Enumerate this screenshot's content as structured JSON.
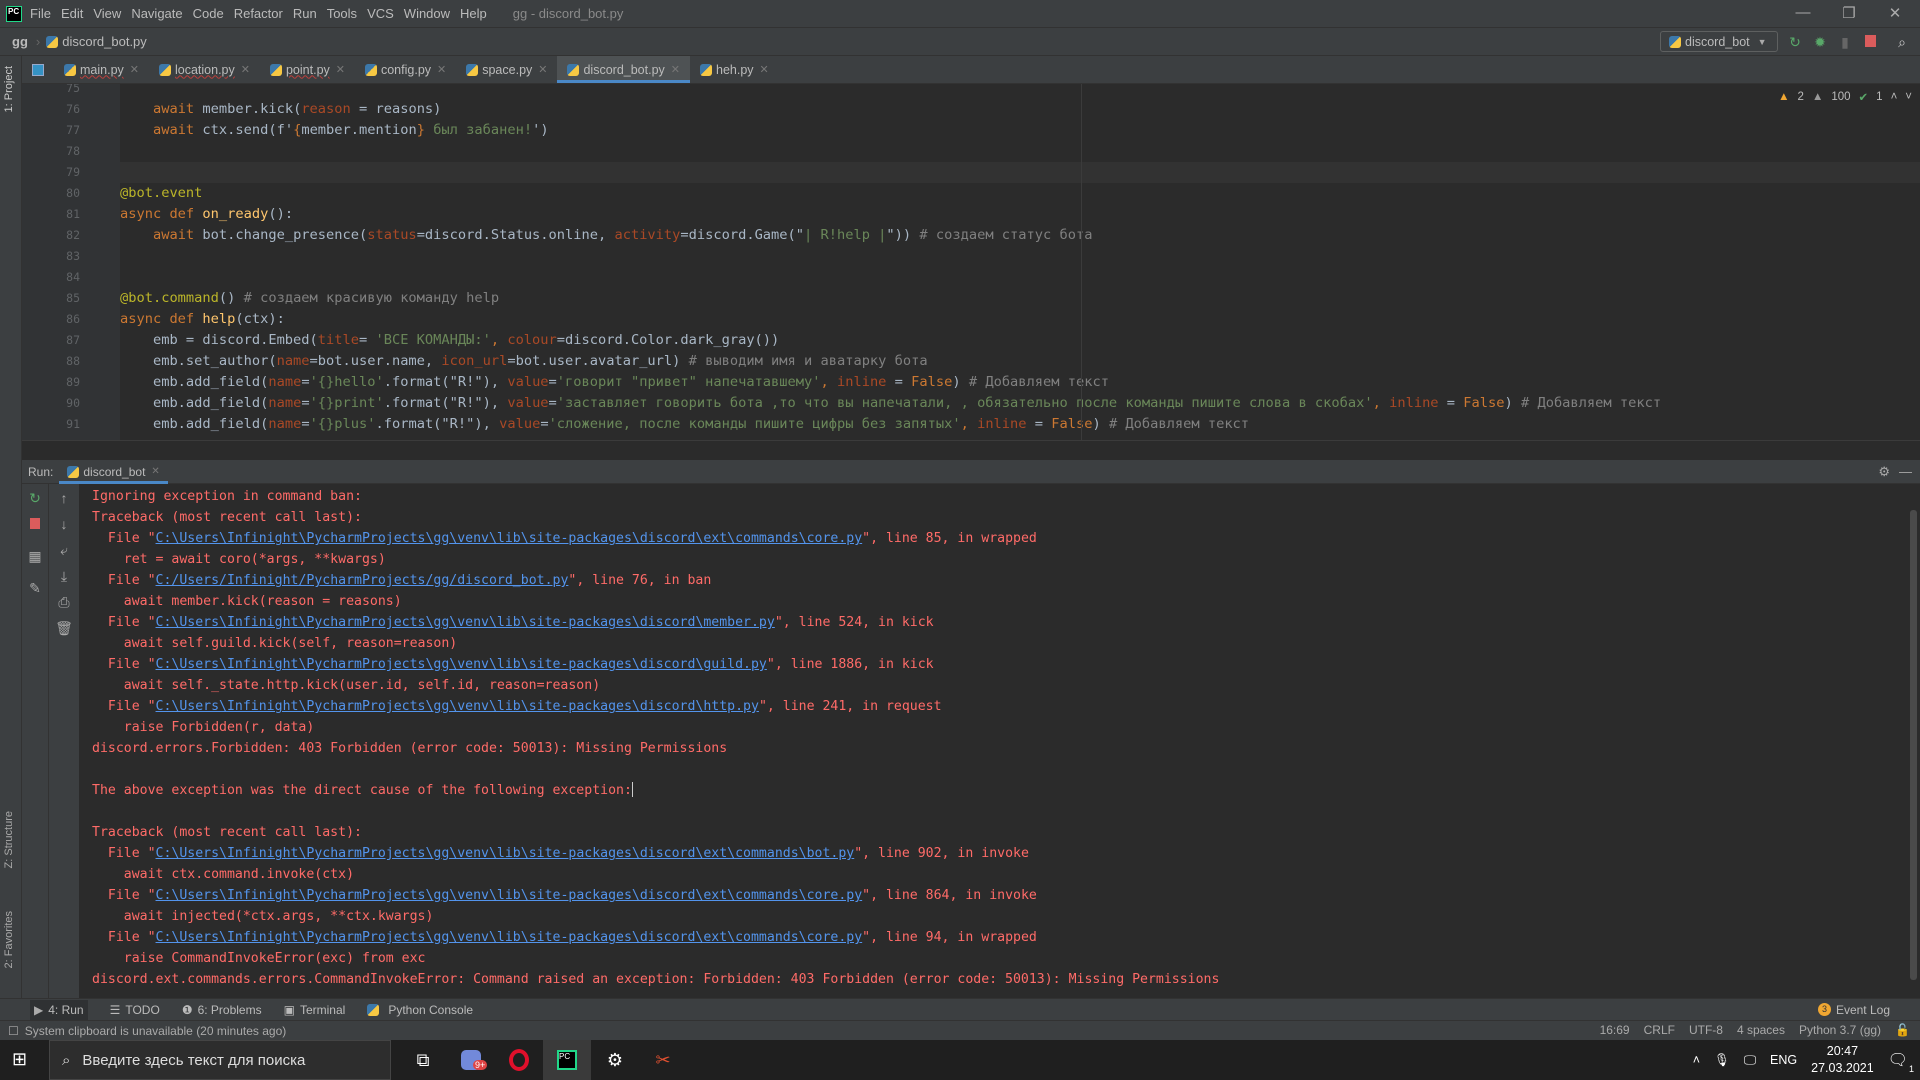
{
  "titlebar": {
    "menu": [
      "File",
      "Edit",
      "View",
      "Navigate",
      "Code",
      "Refactor",
      "Run",
      "Tools",
      "VCS",
      "Window",
      "Help"
    ],
    "window_title": "gg - discord_bot.py"
  },
  "navbar": {
    "breadcrumb": [
      "gg",
      "discord_bot.py"
    ],
    "run_config": "discord_bot"
  },
  "left_strip": {
    "project": "1: Project",
    "structure": "Z: Structure",
    "favorites": "2: Favorites"
  },
  "tabs": [
    {
      "label": "main.py",
      "active": false
    },
    {
      "label": "location.py",
      "active": false
    },
    {
      "label": "point.py",
      "active": false
    },
    {
      "label": "config.py",
      "active": false
    },
    {
      "label": "space.py",
      "active": false
    },
    {
      "label": "discord_bot.py",
      "active": true
    },
    {
      "label": "heh.py",
      "active": false
    }
  ],
  "inspections": {
    "warnings": "2",
    "weak_warnings": "100",
    "typos": "1"
  },
  "editor": {
    "current_line": 79,
    "lines": [
      {
        "n": "75",
        "tokens": []
      },
      {
        "n": "76",
        "tokens": [
          [
            "    ",
            "tx"
          ],
          [
            "await ",
            "kw"
          ],
          [
            "member.kick(",
            "tx"
          ],
          [
            "reason",
            "par"
          ],
          [
            " = reasons)",
            "tx"
          ]
        ]
      },
      {
        "n": "77",
        "tokens": [
          [
            "    ",
            "tx"
          ],
          [
            "await ",
            "kw"
          ],
          [
            "ctx.send(f'",
            "tx"
          ],
          [
            "{",
            "kw"
          ],
          [
            "member.mention",
            "tx"
          ],
          [
            "}",
            "kw"
          ],
          [
            " был забанен!",
            "str"
          ],
          [
            "')",
            "tx"
          ]
        ]
      },
      {
        "n": "78",
        "tokens": []
      },
      {
        "n": "79",
        "tokens": []
      },
      {
        "n": "80",
        "tokens": [
          [
            "@bot.event",
            "dec"
          ]
        ]
      },
      {
        "n": "81",
        "tokens": [
          [
            "async def ",
            "kw"
          ],
          [
            "on_ready",
            "fn"
          ],
          [
            "():",
            "tx"
          ]
        ]
      },
      {
        "n": "82",
        "tokens": [
          [
            "    ",
            "tx"
          ],
          [
            "await ",
            "kw"
          ],
          [
            "bot.change_presence(",
            "tx"
          ],
          [
            "status",
            "par"
          ],
          [
            "=discord.Status.online, ",
            "tx"
          ],
          [
            "activity",
            "par"
          ],
          [
            "=discord.Game(\"",
            "tx"
          ],
          [
            "| R!help |",
            "str"
          ],
          [
            "\")) ",
            "tx"
          ],
          [
            "# создаем статус бота",
            "cm"
          ]
        ]
      },
      {
        "n": "83",
        "tokens": []
      },
      {
        "n": "84",
        "tokens": []
      },
      {
        "n": "85",
        "tokens": [
          [
            "@bot.command",
            "dec"
          ],
          [
            "() ",
            "tx"
          ],
          [
            "# создаем красивую команду help",
            "cm"
          ]
        ]
      },
      {
        "n": "86",
        "tokens": [
          [
            "async def ",
            "kw"
          ],
          [
            "help",
            "fn"
          ],
          [
            "(ctx):",
            "tx"
          ]
        ]
      },
      {
        "n": "87",
        "tokens": [
          [
            "    emb = discord.Embed(",
            "tx"
          ],
          [
            "title",
            "par"
          ],
          [
            "= ",
            "tx"
          ],
          [
            "'ВСЕ КОМАНДЫ:'",
            "str"
          ],
          [
            ", ",
            "kw"
          ],
          [
            "colour",
            "par"
          ],
          [
            "=discord.Color.dark_gray())",
            "tx"
          ]
        ]
      },
      {
        "n": "88",
        "tokens": [
          [
            "    emb.set_author(",
            "tx"
          ],
          [
            "name",
            "par"
          ],
          [
            "=bot.user.name, ",
            "tx"
          ],
          [
            "icon_url",
            "par"
          ],
          [
            "=bot.user.avatar_url) ",
            "tx"
          ],
          [
            "# выводим имя и аватарку бота",
            "cm"
          ]
        ]
      },
      {
        "n": "89",
        "tokens": [
          [
            "    emb.add_field(",
            "tx"
          ],
          [
            "name",
            "par"
          ],
          [
            "=",
            "tx"
          ],
          [
            "'{}hello'",
            "str"
          ],
          [
            ".format(\"R!\"), ",
            "tx"
          ],
          [
            "value",
            "par"
          ],
          [
            "=",
            "tx"
          ],
          [
            "'говорит \"привет\" напечатавшему'",
            "str"
          ],
          [
            ", ",
            "kw"
          ],
          [
            "inline",
            "par"
          ],
          [
            " = ",
            "tx"
          ],
          [
            "False",
            "kw"
          ],
          [
            ") ",
            "tx"
          ],
          [
            "# Добавляем текст",
            "cm"
          ]
        ]
      },
      {
        "n": "90",
        "tokens": [
          [
            "    emb.add_field(",
            "tx"
          ],
          [
            "name",
            "par"
          ],
          [
            "=",
            "tx"
          ],
          [
            "'{}print'",
            "str"
          ],
          [
            ".format(\"R!\"), ",
            "tx"
          ],
          [
            "value",
            "par"
          ],
          [
            "=",
            "tx"
          ],
          [
            "'заставляет говорить бота ,то что вы напечатали, , обязательно после команды пишите слова в скобах'",
            "str"
          ],
          [
            ", ",
            "kw"
          ],
          [
            "inline",
            "par"
          ],
          [
            " = ",
            "tx"
          ],
          [
            "False",
            "kw"
          ],
          [
            ") ",
            "tx"
          ],
          [
            "# Добавляем текст",
            "cm"
          ]
        ]
      },
      {
        "n": "91",
        "tokens": [
          [
            "    emb.add_field(",
            "tx"
          ],
          [
            "name",
            "par"
          ],
          [
            "=",
            "tx"
          ],
          [
            "'{}plus'",
            "str"
          ],
          [
            ".format(\"R!\"), ",
            "tx"
          ],
          [
            "value",
            "par"
          ],
          [
            "=",
            "tx"
          ],
          [
            "'сложение, после команды пишите цифры без запятых'",
            "str"
          ],
          [
            ", ",
            "kw"
          ],
          [
            "inline",
            "par"
          ],
          [
            " = ",
            "tx"
          ],
          [
            "False",
            "kw"
          ],
          [
            ") ",
            "tx"
          ],
          [
            "# Добавляем текст",
            "cm"
          ]
        ]
      }
    ]
  },
  "run": {
    "label": "Run:",
    "tab": "discord_bot",
    "output": [
      {
        "pre": "Ignoring exception in command ban:"
      },
      {
        "pre": "Traceback (most recent call last):"
      },
      {
        "pre": "  File \"",
        "link": "C:\\Users\\Infinight\\PycharmProjects\\gg\\venv\\lib\\site-packages\\discord\\ext\\commands\\core.py",
        "post": "\", line 85, in wrapped"
      },
      {
        "pre": "    ret = await coro(*args, **kwargs)"
      },
      {
        "pre": "  File \"",
        "link": "C:/Users/Infinight/PycharmProjects/gg/discord_bot.py",
        "post": "\", line 76, in ban"
      },
      {
        "pre": "    await member.kick(reason = reasons)"
      },
      {
        "pre": "  File \"",
        "link": "C:\\Users\\Infinight\\PycharmProjects\\gg\\venv\\lib\\site-packages\\discord\\member.py",
        "post": "\", line 524, in kick"
      },
      {
        "pre": "    await self.guild.kick(self, reason=reason)"
      },
      {
        "pre": "  File \"",
        "link": "C:\\Users\\Infinight\\PycharmProjects\\gg\\venv\\lib\\site-packages\\discord\\guild.py",
        "post": "\", line 1886, in kick"
      },
      {
        "pre": "    await self._state.http.kick(user.id, self.id, reason=reason)"
      },
      {
        "pre": "  File \"",
        "link": "C:\\Users\\Infinight\\PycharmProjects\\gg\\venv\\lib\\site-packages\\discord\\http.py",
        "post": "\", line 241, in request"
      },
      {
        "pre": "    raise Forbidden(r, data)"
      },
      {
        "pre": "discord.errors.Forbidden: 403 Forbidden (error code: 50013): Missing Permissions"
      },
      {
        "pre": ""
      },
      {
        "pre": "The above exception was the direct cause of the following exception:",
        "caret": true
      },
      {
        "pre": ""
      },
      {
        "pre": "Traceback (most recent call last):"
      },
      {
        "pre": "  File \"",
        "link": "C:\\Users\\Infinight\\PycharmProjects\\gg\\venv\\lib\\site-packages\\discord\\ext\\commands\\bot.py",
        "post": "\", line 902, in invoke"
      },
      {
        "pre": "    await ctx.command.invoke(ctx)"
      },
      {
        "pre": "  File \"",
        "link": "C:\\Users\\Infinight\\PycharmProjects\\gg\\venv\\lib\\site-packages\\discord\\ext\\commands\\core.py",
        "post": "\", line 864, in invoke"
      },
      {
        "pre": "    await injected(*ctx.args, **ctx.kwargs)"
      },
      {
        "pre": "  File \"",
        "link": "C:\\Users\\Infinight\\PycharmProjects\\gg\\venv\\lib\\site-packages\\discord\\ext\\commands\\core.py",
        "post": "\", line 94, in wrapped"
      },
      {
        "pre": "    raise CommandInvokeError(exc) from exc"
      },
      {
        "pre": "discord.ext.commands.errors.CommandInvokeError: Command raised an exception: Forbidden: 403 Forbidden (error code: 50013): Missing Permissions"
      }
    ]
  },
  "tool_tabs": {
    "run": "4: Run",
    "todo": "TODO",
    "problems": "6: Problems",
    "terminal": "Terminal",
    "python_console": "Python Console",
    "event_log": "Event Log",
    "event_count": "3"
  },
  "statusbar": {
    "message": "System clipboard is unavailable (20 minutes ago)",
    "position": "16:69",
    "line_sep": "CRLF",
    "encoding": "UTF-8",
    "indent": "4 spaces",
    "interpreter": "Python 3.7 (gg)"
  },
  "taskbar": {
    "search_placeholder": "Введите здесь текст для поиска",
    "discord_badge": "9+",
    "lang": "ENG",
    "time": "20:47",
    "date": "27.03.2021",
    "notifications": "1"
  },
  "colors": {
    "error": "#ff6b68",
    "link": "#5394ec",
    "accent": "#4a88c7",
    "keyword": "#cc7832",
    "string": "#6a8759"
  }
}
